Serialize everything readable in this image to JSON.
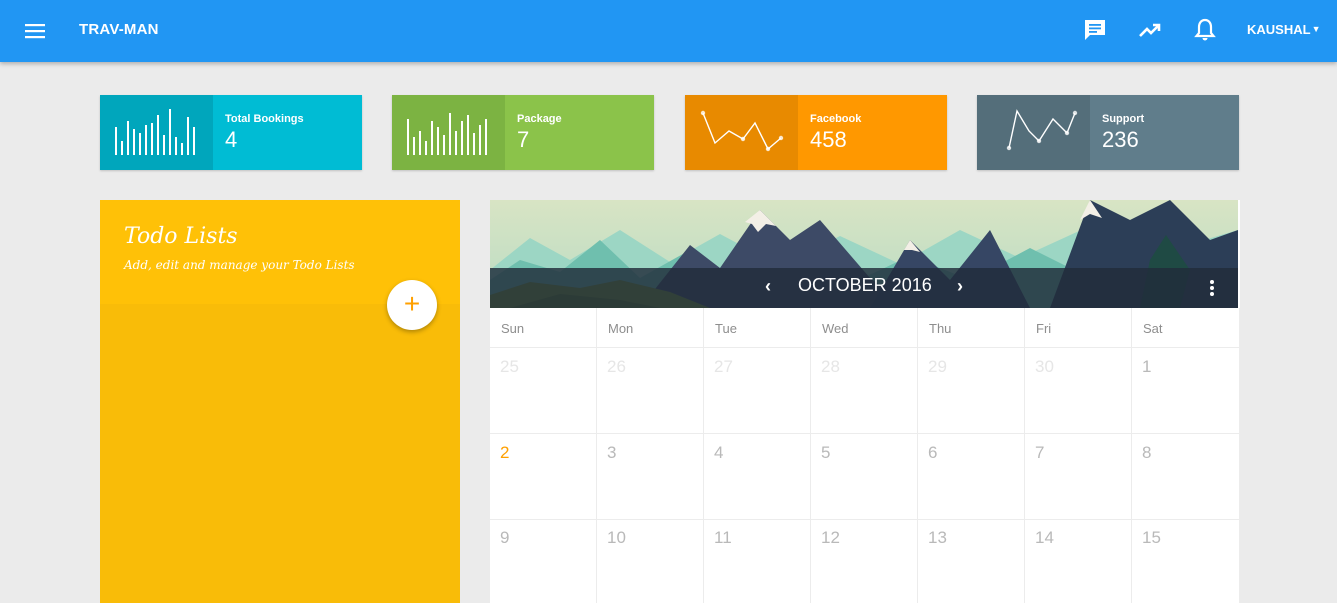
{
  "app": {
    "brand": "TRAV-MAN",
    "user_name": "KAUSHAL",
    "icons": [
      "menu-icon",
      "chat-icon",
      "trending-up-icon",
      "bell-icon"
    ]
  },
  "stats": [
    {
      "label": "Total Bookings",
      "value": "4",
      "color": "#00bcd4",
      "dark": "#00a6bc",
      "chart": "bars"
    },
    {
      "label": "Package",
      "value": "7",
      "color": "#8bc34a",
      "dark": "#7cb342",
      "chart": "bars"
    },
    {
      "label": "Facebook",
      "value": "458",
      "color": "#ff9800",
      "dark": "#e88a00",
      "chart": "line"
    },
    {
      "label": "Support",
      "value": "236",
      "color": "#607d8b",
      "dark": "#546e7a",
      "chart": "line"
    }
  ],
  "todo": {
    "title": "Todo Lists",
    "subtitle": "Add, edit and manage your Todo Lists",
    "add_label": "+",
    "color": "#ffc107"
  },
  "calendar": {
    "month_label": "OCTOBER 2016",
    "weekdays": [
      "Sun",
      "Mon",
      "Tue",
      "Wed",
      "Thu",
      "Fri",
      "Sat"
    ],
    "weeks": [
      [
        {
          "d": "25",
          "muted": true
        },
        {
          "d": "26",
          "muted": true
        },
        {
          "d": "27",
          "muted": true
        },
        {
          "d": "28",
          "muted": true
        },
        {
          "d": "29",
          "muted": true
        },
        {
          "d": "30",
          "muted": true
        },
        {
          "d": "1"
        }
      ],
      [
        {
          "d": "2",
          "today": true
        },
        {
          "d": "3"
        },
        {
          "d": "4"
        },
        {
          "d": "5"
        },
        {
          "d": "6"
        },
        {
          "d": "7"
        },
        {
          "d": "8"
        }
      ],
      [
        {
          "d": "9"
        },
        {
          "d": "10"
        },
        {
          "d": "11"
        },
        {
          "d": "12"
        },
        {
          "d": "13"
        },
        {
          "d": "14"
        },
        {
          "d": "15"
        }
      ]
    ]
  }
}
